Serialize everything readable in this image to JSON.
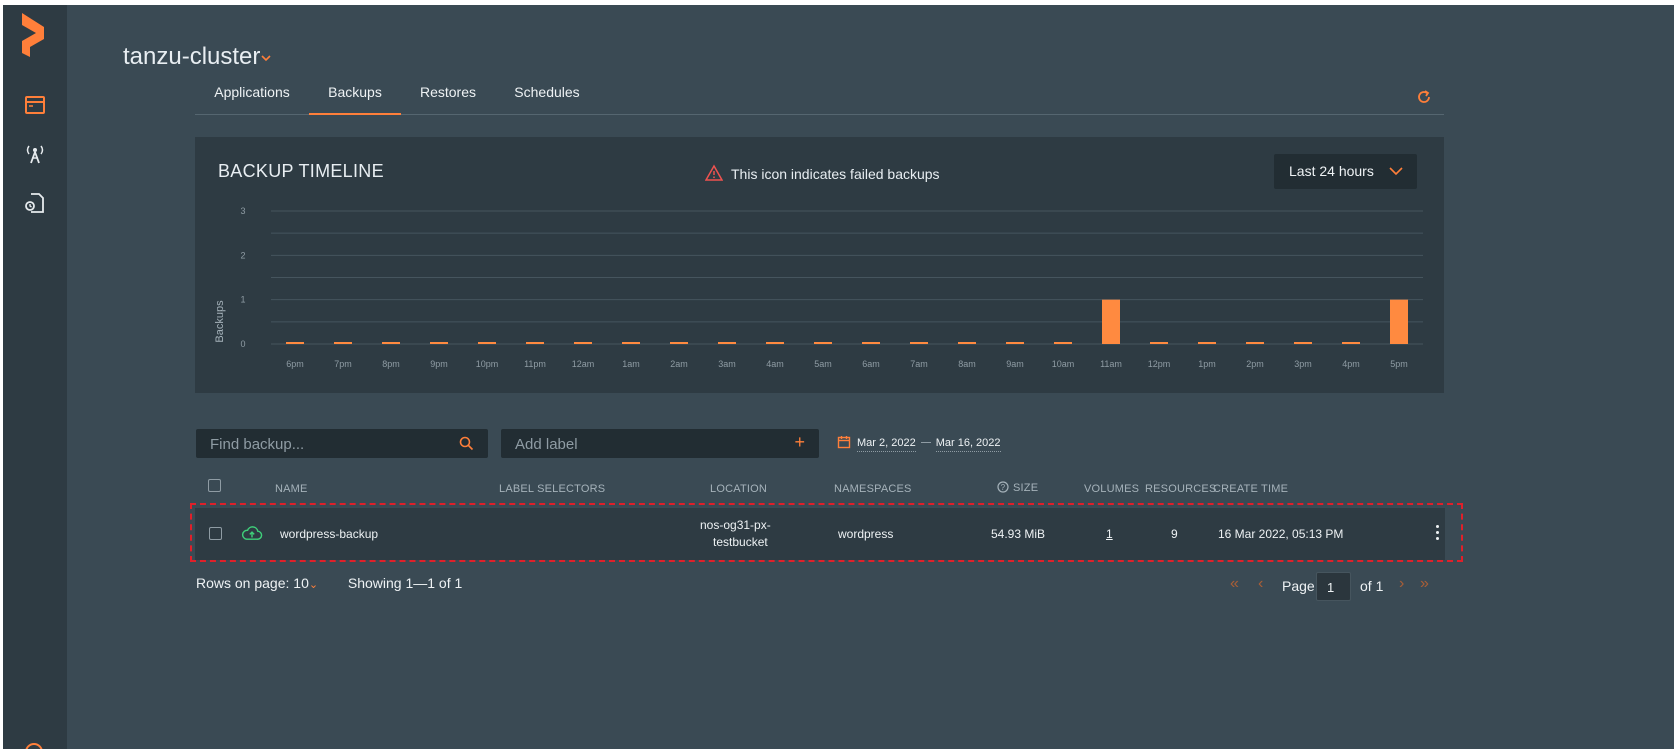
{
  "cluster": {
    "name": "tanzu-cluster"
  },
  "tabs": [
    {
      "label": "Applications",
      "active": false
    },
    {
      "label": "Backups",
      "active": true
    },
    {
      "label": "Restores",
      "active": false
    },
    {
      "label": "Schedules",
      "active": false
    }
  ],
  "timeline": {
    "title": "BACKUP TIMELINE",
    "fail_note": "This icon indicates failed backups",
    "range_label": "Last 24 hours"
  },
  "chart_data": {
    "type": "bar",
    "ylabel": "Backups",
    "ylim": [
      0,
      3
    ],
    "yticks": [
      0,
      1,
      2,
      3
    ],
    "categories": [
      "6pm",
      "7pm",
      "8pm",
      "9pm",
      "10pm",
      "11pm",
      "12am",
      "1am",
      "2am",
      "3am",
      "4am",
      "5am",
      "6am",
      "7am",
      "8am",
      "9am",
      "10am",
      "11am",
      "12pm",
      "1pm",
      "2pm",
      "3pm",
      "4pm",
      "5pm"
    ],
    "values": [
      0,
      0,
      0,
      0,
      0,
      0,
      0,
      0,
      0,
      0,
      0,
      0,
      0,
      0,
      0,
      0,
      0,
      1,
      0,
      0,
      0,
      0,
      0,
      1
    ],
    "bar_color": "#ff8a40",
    "grid": true
  },
  "filters": {
    "search_placeholder": "Find backup...",
    "label_placeholder": "Add label",
    "date_from": "Mar 2, 2022",
    "date_to": "Mar 16, 2022"
  },
  "table": {
    "headers": {
      "name": "NAME",
      "label_selectors": "LABEL SELECTORS",
      "location": "LOCATION",
      "namespaces": "NAMESPACES",
      "size": "SIZE",
      "volumes": "VOLUMES",
      "resources": "RESOURCES",
      "create_time": "CREATE TIME"
    },
    "rows": [
      {
        "name": "wordpress-backup",
        "location_line1": "nos-og31-px-",
        "location_line2": "testbucket",
        "namespaces": "wordpress",
        "size": "54.93 MiB",
        "volumes": "1",
        "resources": "9",
        "create_time": "16 Mar 2022, 05:13 PM",
        "status_icon": "cloud-upload-icon"
      }
    ]
  },
  "pagination": {
    "rows_label": "Rows on page:",
    "rows_value": "10",
    "showing": "Showing 1—1 of 1",
    "page_label": "Page",
    "page_value": "1",
    "of_label": "of 1"
  },
  "colors": {
    "accent": "#ff7f3a",
    "success": "#3fcf7a",
    "failed": "#ef5350"
  }
}
